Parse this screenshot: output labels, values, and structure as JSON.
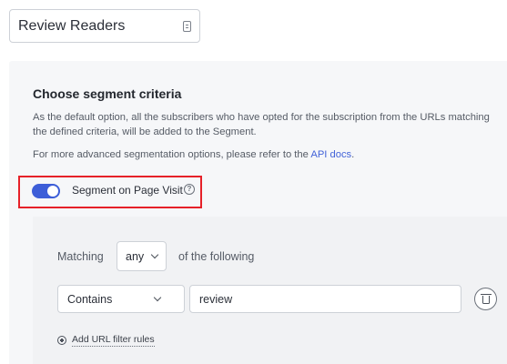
{
  "segment_name": {
    "value": "Review Readers",
    "icon": "card-icon"
  },
  "criteria": {
    "title": "Choose segment criteria",
    "description": "As the default option, all the subscribers who have opted for the subscription from the URLs matching the defined criteria, will be added to the Segment.",
    "advanced_prefix": "For more advanced segmentation options, please refer to the ",
    "advanced_link": "API docs",
    "advanced_suffix": "."
  },
  "toggle": {
    "label": "Segment on Page Visit",
    "state": "on",
    "accent": "#3d5ed8",
    "help_icon": "question-circle-icon",
    "highlight_color": "#e62129"
  },
  "rules": {
    "matching_label": "Matching",
    "match_select_value": "any",
    "following_label": "of the following",
    "condition_select_value": "Contains",
    "value_input": "review",
    "delete_icon": "trash-icon",
    "add_label": "Add URL filter rules",
    "add_icon": "plus-circle-icon"
  }
}
